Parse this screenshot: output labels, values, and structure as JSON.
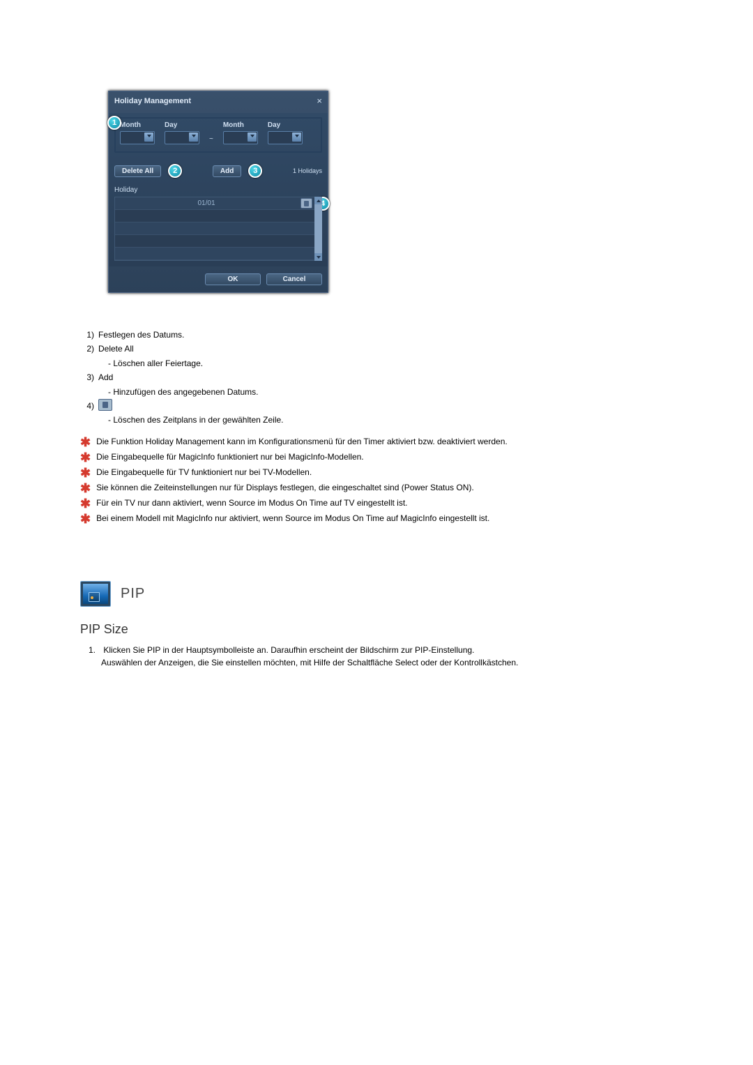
{
  "dialog": {
    "title": "Holiday Management",
    "labels": {
      "month": "Month",
      "day": "Day"
    },
    "buttons": {
      "delete_all": "Delete All",
      "add": "Add",
      "ok": "OK",
      "cancel": "Cancel"
    },
    "count": "1 Holidays",
    "table_header": "Holiday",
    "row_date": "01/01",
    "callouts": {
      "c1": "1",
      "c2": "2",
      "c3": "3",
      "c4": "4"
    }
  },
  "numlist": {
    "i1_num": "1)",
    "i1_text": "Festlegen des Datums.",
    "i2_num": "2)",
    "i2_text": "Delete All",
    "i2_sub": "Löschen aller Feiertage.",
    "i3_num": "3)",
    "i3_text": "Add",
    "i3_sub": "Hinzufügen des angegebenen Datums.",
    "i4_num": "4)",
    "i4_sub": "Löschen des Zeitplans in der gewählten Zeile."
  },
  "notes": {
    "n1": "Die Funktion Holiday Management kann im Konfigurationsmenü für den Timer aktiviert bzw. deaktiviert werden.",
    "n2": "Die Eingabequelle für MagicInfo funktioniert nur bei MagicInfo-Modellen.",
    "n3": "Die Eingabequelle für TV funktioniert nur bei TV-Modellen.",
    "n4": "Sie können die Zeiteinstellungen nur für Displays festlegen, die eingeschaltet sind (Power Status ON).",
    "n5": "Für ein TV nur dann aktiviert, wenn Source im Modus On Time auf TV eingestellt ist.",
    "n6": "Bei einem Modell mit MagicInfo nur aktiviert, wenn Source im Modus On Time auf MagicInfo eingestellt ist."
  },
  "pip": {
    "section": "PIP",
    "sub": "PIP Size",
    "step_num": "1.",
    "step_line1": "Klicken Sie PIP in der Hauptsymbolleiste an. Daraufhin erscheint der Bildschirm zur PIP-Einstellung.",
    "step_line2": "Auswählen der Anzeigen, die Sie einstellen möchten, mit Hilfe der Schaltfläche Select oder der Kontrollkästchen."
  }
}
